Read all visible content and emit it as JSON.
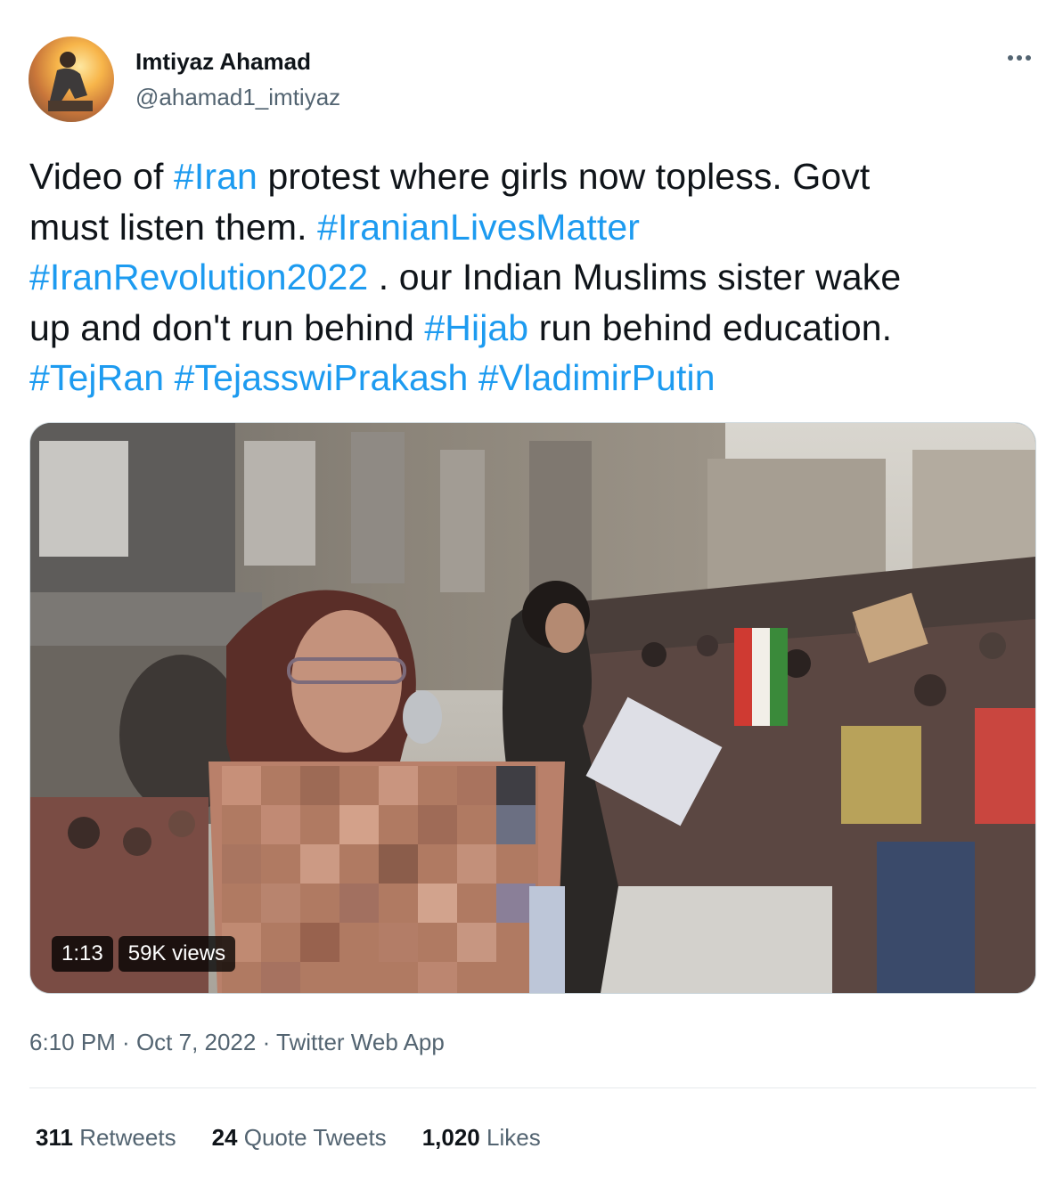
{
  "author": {
    "name": "Imtiyaz Ahamad",
    "handle": "@ahamad1_imtiyaz"
  },
  "text_lines": [
    [
      {
        "t": "Video of ",
        "tag": false
      },
      {
        "t": "#Iran",
        "tag": true
      },
      {
        "t": " protest where girls now topless. Govt",
        "tag": false
      }
    ],
    [
      {
        "t": "must listen them. ",
        "tag": false
      },
      {
        "t": "#IranianLivesMatter",
        "tag": true
      }
    ],
    [
      {
        "t": "#IranRevolution2022",
        "tag": true
      },
      {
        "t": " . our Indian Muslims sister wake",
        "tag": false
      }
    ],
    [
      {
        "t": "up and don't run behind ",
        "tag": false
      },
      {
        "t": "#Hijab",
        "tag": true
      },
      {
        "t": " run behind education.",
        "tag": false
      }
    ],
    [
      {
        "t": "#TejRan",
        "tag": true
      },
      {
        "t": " ",
        "tag": false
      },
      {
        "t": "#TejasswiPrakash",
        "tag": true
      },
      {
        "t": " ",
        "tag": false
      },
      {
        "t": "#VladimirPutin",
        "tag": true
      }
    ]
  ],
  "video": {
    "duration": "1:13",
    "views": "59K views"
  },
  "meta": {
    "time": "6:10 PM",
    "separator": " · ",
    "date": "Oct 7, 2022",
    "app": "Twitter Web App"
  },
  "stats": {
    "retweets_count": "311",
    "retweets_label": "Retweets",
    "quotes_count": "24",
    "quotes_label": "Quote Tweets",
    "likes_count": "1,020",
    "likes_label": "Likes"
  },
  "colors": {
    "hashtag": "#1d9bf0",
    "secondary_text": "#536471",
    "primary_text": "#0f1419"
  },
  "icons": {
    "more": "more-horizontal-icon"
  }
}
